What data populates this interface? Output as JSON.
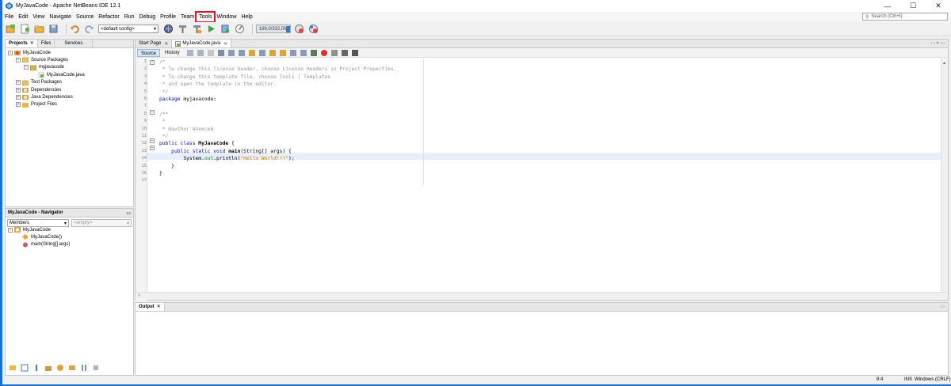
{
  "window": {
    "title": "MyJavaCode - Apache NetBeans IDE 12.1",
    "min": "—",
    "max": "☐",
    "close": "✕"
  },
  "menu": [
    {
      "label": "File"
    },
    {
      "label": "Edit"
    },
    {
      "label": "View"
    },
    {
      "label": "Navigate"
    },
    {
      "label": "Source"
    },
    {
      "label": "Refactor"
    },
    {
      "label": "Run"
    },
    {
      "label": "Debug"
    },
    {
      "label": "Profile"
    },
    {
      "label": "Team"
    },
    {
      "label": "Tools",
      "highlighted": true
    },
    {
      "label": "Window"
    },
    {
      "label": "Help"
    }
  ],
  "search": {
    "placeholder": "Search (Ctrl+I)"
  },
  "toolbar": {
    "config": "<default config>",
    "memory": "169,0/332,0M"
  },
  "projects_panel": {
    "tabs": [
      "Projects",
      "Files",
      "Services"
    ],
    "tree": [
      {
        "label": "MyJavaCode",
        "level": 0,
        "icon": "project-icon",
        "exp": "−"
      },
      {
        "label": "Source Packages",
        "level": 1,
        "icon": "package-folder-icon",
        "exp": "−"
      },
      {
        "label": "myjavacode",
        "level": 2,
        "icon": "package-icon",
        "exp": "−"
      },
      {
        "label": "MyJavaCode.java",
        "level": 3,
        "icon": "java-file-icon",
        "exp": ""
      },
      {
        "label": "Test Packages",
        "level": 1,
        "icon": "package-folder-icon",
        "exp": "+"
      },
      {
        "label": "Dependencies",
        "level": 1,
        "icon": "library-icon",
        "exp": "+"
      },
      {
        "label": "Java Dependencies",
        "level": 1,
        "icon": "library-icon",
        "exp": "+"
      },
      {
        "label": "Project Files",
        "level": 1,
        "icon": "folder-icon",
        "exp": "+"
      }
    ]
  },
  "navigator": {
    "title": "MyJavaCode - Navigator",
    "filter": "Members",
    "empty": "<empty>",
    "tree": [
      {
        "label": "MyJavaCode",
        "level": 0,
        "icon": "class-icon",
        "exp": "−"
      },
      {
        "label": "MyJavaCode()",
        "level": 1,
        "icon": "constructor-icon",
        "exp": ""
      },
      {
        "label": "main(String[] args)",
        "level": 1,
        "icon": "method-icon",
        "exp": ""
      }
    ]
  },
  "editor": {
    "tabs": [
      {
        "label": "Start Page",
        "active": false
      },
      {
        "label": "MyJavaCode.java",
        "active": true
      }
    ],
    "source_btn": "Source",
    "history_btn": "History",
    "lines": [
      {
        "n": "1",
        "html": "<span class='cm'>/*</span>"
      },
      {
        "n": "2",
        "html": "<span class='cm'> * To change this license header, choose License Headers in Project Properties.</span>"
      },
      {
        "n": "3",
        "html": "<span class='cm'> * To change this template file, choose Tools | Templates</span>"
      },
      {
        "n": "4",
        "html": "<span class='cm'> * and open the template in the editor.</span>"
      },
      {
        "n": "5",
        "html": "<span class='cm'> */</span>"
      },
      {
        "n": "6",
        "html": "<span class='kw'>package</span> myjavacode;"
      },
      {
        "n": "7",
        "html": ""
      },
      {
        "n": "8",
        "html": "<span class='cm'>/**</span>"
      },
      {
        "n": "9",
        "html": "<span class='cm'> *</span>"
      },
      {
        "n": "10",
        "html": "<span class='cm'> * @author Алексей</span>"
      },
      {
        "n": "11",
        "html": "<span class='cm'> */</span>"
      },
      {
        "n": "12",
        "html": "<span class='kw'>public class</span> <span class='bold'>MyJavaCode</span> {"
      },
      {
        "n": "13",
        "html": "    <span class='kw'>public static void</span> <span class='bold'>main</span>(String[] args) {"
      },
      {
        "n": "14",
        "html": "        System.<span class='fld'>out</span>.println(<span class='str'>\"Hello World!!!\"</span>);"
      },
      {
        "n": "15",
        "html": "    }"
      },
      {
        "n": "16",
        "html": "}"
      },
      {
        "n": "17",
        "html": ""
      }
    ]
  },
  "output": {
    "tab": "Output"
  },
  "status": {
    "position": "8:4",
    "mode": "INS",
    "eol": "Windows (CRLF)"
  }
}
